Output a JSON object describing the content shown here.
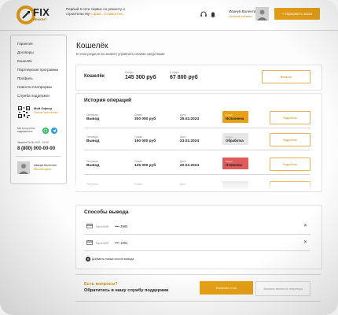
{
  "header": {
    "logo_text": "FIX",
    "logo_sub": "REMONT",
    "tagline_before": "Первый в сети сервис по ремонту и строительству",
    "tagline_accent": "с фикс. стоимостью",
    "user_name": "Иванув Валентин",
    "user_link": "Личный кабинет",
    "cta": "+ Оформить заказ"
  },
  "sidebar": {
    "items": [
      {
        "label": "Гарантия"
      },
      {
        "label": "Договоры"
      },
      {
        "label": "Кошелёк"
      },
      {
        "label": "Партнерская программа"
      },
      {
        "label": "Профиль"
      },
      {
        "label": "Новости платформы"
      },
      {
        "label": "Служба поддержки"
      }
    ],
    "qr_title": "Мой Офлер",
    "qr_sub": "Скачать приложение",
    "social_caption": "Мы в соц сетях подпишитесь",
    "hours": "Звоните Пн-Вс 9:00 - 21:00",
    "phone": "8 (800) 000-00-00",
    "manager_name": "Иванув Валентин",
    "manager_link": "Ваш менеджер"
  },
  "page": {
    "title": "Кошелёк",
    "subtitle": "В этом разделе вы можете управлять своими средствами"
  },
  "wallet": {
    "label": "Кошелёк",
    "balance_label": "Баланс",
    "balance": "145 300 руб",
    "pending_label": "В ойдсе",
    "pending": "67 800 руб",
    "withdraw": "Вывести"
  },
  "history": {
    "title": "История операций",
    "col_op": "Операция",
    "col_sum": "Сумма",
    "col_date": "Дата",
    "col_status": "Статус",
    "rows": [
      {
        "op": "Вывод",
        "sum": "300 000 руб",
        "date": "25.02.2024",
        "status": "Исполнена",
        "status_color": "#e8a117",
        "action": "Подробнее"
      },
      {
        "op": "Вывод",
        "sum": "150 000 руб",
        "date": "23.02.2024",
        "status": "Обработка",
        "status_color": "#e6e6e6",
        "action": "Подробнее"
      },
      {
        "op": "Вывод",
        "sum": "125 000 руб",
        "date": "20.02.2024",
        "status": "Отменена",
        "status_color": "#e05a5a",
        "action": "Подробнее"
      },
      {
        "op": "Вывод",
        "sum": "",
        "date": "",
        "status": "",
        "status_color": "#e6e6e6",
        "action": ""
      }
    ]
  },
  "withdraw_methods": {
    "title": "Способы вывода",
    "cards": [
      {
        "label": "Карта МИР",
        "number": "•••• 3980"
      },
      {
        "label": "Карта МИР",
        "number": "•••• 1081"
      }
    ],
    "add": "Добавить новый способ вывода"
  },
  "support": {
    "question": "Есть вопросы?",
    "subtitle": "Обратитесь в нашу службу поддержки",
    "btn1": "Написать в чат",
    "btn2": "Заказать звонок от оператора"
  },
  "colors": {
    "accent": "#e8a117",
    "danger": "#e05a5a"
  }
}
